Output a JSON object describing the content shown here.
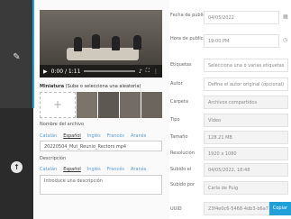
{
  "video": {
    "time": "0:00 / 1:11"
  },
  "thumbnail": {
    "label_bold": "Miniatura",
    "label_rest": " (Sube o selecciona una aleatoria)"
  },
  "languages": [
    "Catalán",
    "Español",
    "Inglés",
    "Francés",
    "Aranés"
  ],
  "filename": {
    "label": "Nombre del archivo",
    "value": "20220504_Mut_Reunio_Rectors.mp4"
  },
  "description": {
    "label": "Descripción",
    "placeholder": "Introduce una descripción"
  },
  "details": {
    "fecha_label": "Fecha de publicación",
    "fecha_value": "04/05/2022",
    "hora_label": "Hora de publicación",
    "hora_value": "19:00 PM",
    "etiquetas_label": "Etiquetas",
    "etiquetas_value": "Selecciona una o varias etiquetas",
    "autor_label": "Autor",
    "autor_value": "Define el autor original (opcional)",
    "carpeta_label": "Carpeta",
    "carpeta_value": "Archivos compartidos",
    "tipo_label": "Tipo",
    "tipo_value": "Vídeo",
    "tamano_label": "Tamaño",
    "tamano_value": "128.21 MB",
    "resolucion_label": "Resolución",
    "resolucion_value": "1920 x 1080",
    "subido_el_label": "Subido el",
    "subido_el_value": "04/05/2022, 18:48",
    "subido_por_label": "Subido por",
    "subido_por_value": "Carla de Puig",
    "uuid_label": "UUID",
    "uuid_value": "23f4e0c6-5468-4db3-b6a7"
  },
  "buttons": {
    "copy": "Copiar"
  }
}
